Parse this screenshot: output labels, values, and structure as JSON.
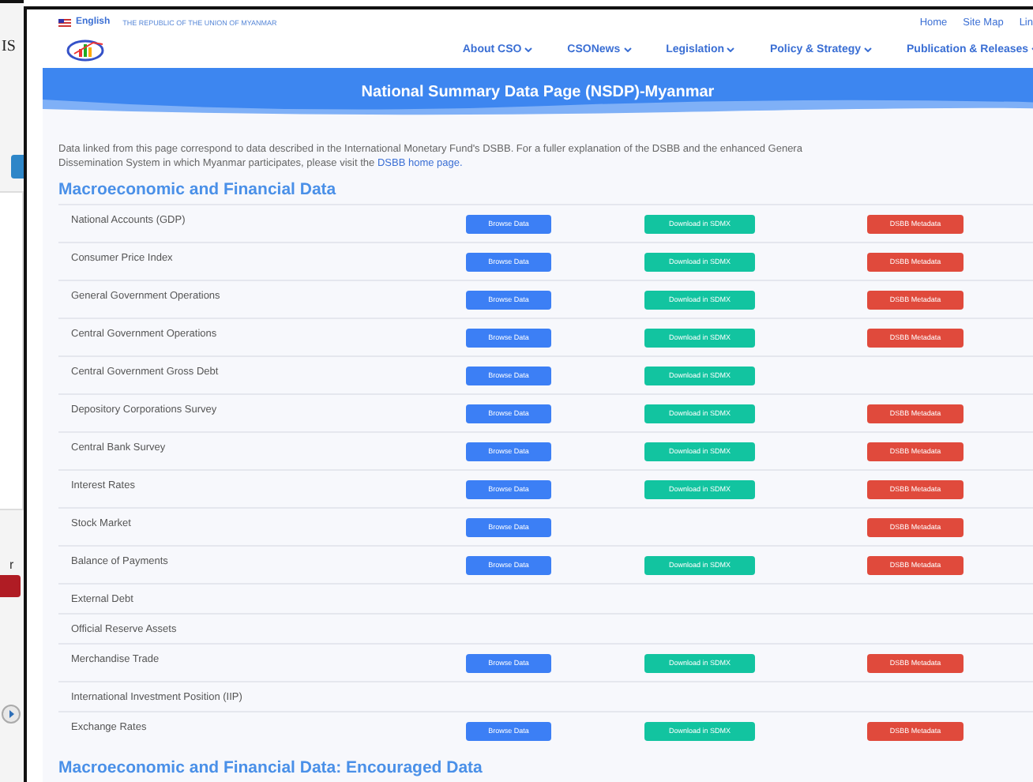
{
  "background_window": {
    "title_fragment": "IS",
    "label_fragment": "r"
  },
  "top_bar": {
    "language": "English",
    "tagline": "THE REPUBLIC OF THE UNION OF MYANMAR",
    "links": [
      "Home",
      "Site Map",
      "Lin"
    ]
  },
  "nav": [
    "About CSO",
    "CSONews",
    "Legislation",
    "Policy & Strategy",
    "Publication & Releases"
  ],
  "banner_title": "National Summary Data Page (NSDP)-Myanmar",
  "intro": {
    "line_1": "Data linked from this page correspond to data described in the International Monetary Fund's DSBB. For a fuller explanation of the DSBB and the enhanced Genera",
    "line_2": "Dissemination System in which Myanmar participates, please visit the",
    "link": "DSBB home page."
  },
  "sections": [
    {
      "title": "Macroeconomic and Financial Data",
      "rows": [
        {
          "label": "National Accounts (GDP)",
          "browse": "Browse Data",
          "download": "Download in SDMX",
          "metadata": "DSBB Metadata"
        },
        {
          "label": "Consumer Price Index",
          "browse": "Browse Data",
          "download": "Download in SDMX",
          "metadata": "DSBB Metadata"
        },
        {
          "label": "General Government Operations",
          "browse": "Browse Data",
          "download": "Download in SDMX",
          "metadata": "DSBB Metadata"
        },
        {
          "label": "Central Government Operations",
          "browse": "Browse Data",
          "download": "Download in SDMX",
          "metadata": "DSBB Metadata"
        },
        {
          "label": "Central Government Gross Debt",
          "browse": "Browse Data",
          "download": "Download in SDMX"
        },
        {
          "label": "Depository Corporations Survey",
          "browse": "Browse Data",
          "download": "Download in SDMX",
          "metadata": "DSBB Metadata"
        },
        {
          "label": "Central Bank Survey",
          "browse": "Browse Data",
          "download": "Download in SDMX",
          "metadata": "DSBB Metadata"
        },
        {
          "label": "Interest Rates",
          "browse": "Browse Data",
          "download": "Download in SDMX",
          "metadata": "DSBB Metadata"
        },
        {
          "label": "Stock Market",
          "browse": "Browse Data",
          "metadata": "DSBB Metadata"
        },
        {
          "label": "Balance of Payments",
          "browse": "Browse Data",
          "download": "Download in SDMX",
          "metadata": "DSBB Metadata"
        },
        {
          "label": "External Debt"
        },
        {
          "label": "Official Reserve Assets"
        },
        {
          "label": "Merchandise Trade",
          "browse": "Browse Data",
          "download": "Download in SDMX",
          "metadata": "DSBB Metadata"
        },
        {
          "label": "International Investment Position (IIP)"
        },
        {
          "label": "Exchange Rates",
          "browse": "Browse Data",
          "download": "Download in SDMX",
          "metadata": "DSBB Metadata"
        }
      ]
    },
    {
      "title": "Macroeconomic and Financial Data: Encouraged Data"
    }
  ]
}
